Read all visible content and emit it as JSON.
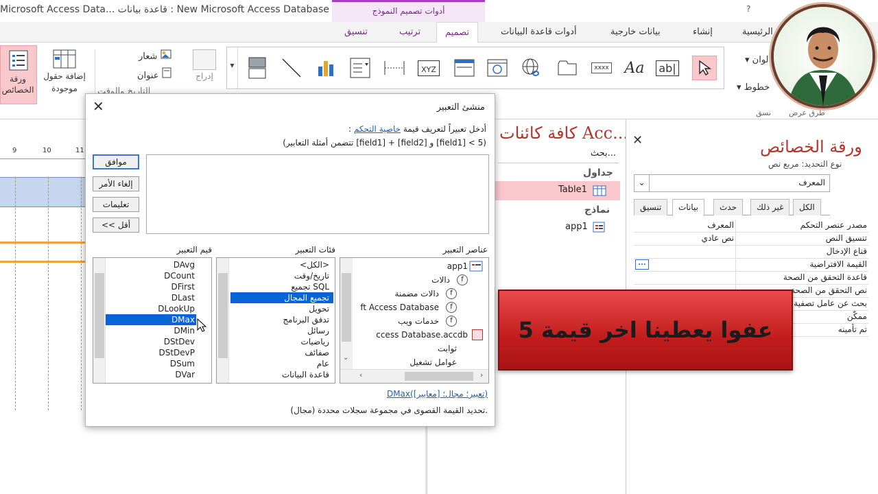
{
  "window": {
    "title": "Microsoft Access Data... قاعدة بيانات : New Microsoft Access Database",
    "context_tools": "أدوات تصميم النموذج",
    "help_glyph": "?"
  },
  "tabs": {
    "home": "الصفحة الرئيسية",
    "create": "إنشاء",
    "external": "بيانات خارجية",
    "dbtools": "أدوات قاعدة البيانات",
    "design": "تصميم",
    "arrange": "ترتيب",
    "format": "تنسيق"
  },
  "ribbon": {
    "property_sheet": "ورقة الخصائص",
    "add_existing_fields": "إضافة حقول موجودة",
    "logo": "شعار",
    "title": "عنوان",
    "insert_image": "إدراج صورة",
    "date_time": "التاريخ والوقت",
    "views_small": "طرق عرض",
    "themes_small": "نسق",
    "fonts_small": "خطوط",
    "colors_small": "ألوان",
    "xyz": "XYZ",
    "xxxx": "xxxx",
    "aa": "Aa",
    "ab": "ab|"
  },
  "nav": {
    "title": "كافة كائنات Acc...",
    "search": "بحث...",
    "tables": "جداول",
    "table1": "Table1",
    "forms": "نماذج",
    "app1": "app1"
  },
  "props": {
    "title": "ورقة الخصائص",
    "selection_type": "نوع التحديد:  مربع نص",
    "combo_value": "المعرف",
    "tabs": [
      "تنسيق",
      "بيانات",
      "حدث",
      "غير ذلك",
      "الكل"
    ],
    "rows": [
      {
        "label": "مصدر عنصر التحكم",
        "value": "المعرف"
      },
      {
        "label": "تنسيق النص",
        "value": "نص عادي"
      },
      {
        "label": "قناع الإدخال",
        "value": ""
      },
      {
        "label": "القيمة الافتراضية",
        "value": "..."
      },
      {
        "label": "قاعدة التحقق من الصحة",
        "value": ""
      },
      {
        "label": "نص التحقق من الصحة",
        "value": ""
      },
      {
        "label": "بحث عن عامل تصفية",
        "value": ""
      },
      {
        "label": "ممكّن",
        "value": ""
      },
      {
        "label": "تم تأمينه",
        "value": ""
      }
    ]
  },
  "dialog": {
    "title": "منشئ التعبير",
    "prompt_pre": "أدخل تعبيراً لتعريف قيمة",
    "prompt_link": "خاصية التحكم",
    "prompt_post": ":",
    "example": "(تتضمن أمثلة التعابير [field1] + [field2] و [field1] < 5)",
    "buttons": {
      "ok": "موافق",
      "cancel": "إلغاء الأمر",
      "help": "تعليمات",
      "less": "<< أقل"
    },
    "headers": {
      "elements": "عناصر التعبير",
      "categories": "فئات التعبير",
      "values": "قيم التعبير"
    },
    "elements": [
      "app1",
      "دالات",
      "دالات مضمنة",
      "ft Access Database",
      "خدمات ويب",
      "ccess Database.accdb",
      "ثوابت",
      "عوامل تشغيل"
    ],
    "categories": [
      "<الكل>",
      "تاريخ/وقت",
      "تجميع SQL",
      "تجميع المجال",
      "تحويل",
      "تدفق البرنامج",
      "رسائل",
      "رياضيات",
      "صفائف",
      "عام",
      "قاعدة البيانات"
    ],
    "values": [
      "DAvg",
      "DCount",
      "DFirst",
      "DLast",
      "DLookUp",
      "DMax",
      "DMin",
      "DStDev",
      "DStDevP",
      "DSum",
      "DVar"
    ],
    "selected_category": "تجميع المجال",
    "selected_value": "DMax",
    "syntax": "DMax(تعبير؛ مجال؛ [معايير])",
    "description": "تحديد القيمة القصوى في مجموعة سجلات محددة (مجال)."
  },
  "ruler": {
    "n9": "9",
    "n10": "10",
    "n11": "11"
  },
  "banner": {
    "text": "عفوا يعطينا اخر قيمة 5"
  },
  "colors": {
    "accent_red": "#b5352c",
    "selection_blue": "#0a64d8",
    "context_purple": "#a33fb7",
    "banner_red": "#d02a2a"
  }
}
